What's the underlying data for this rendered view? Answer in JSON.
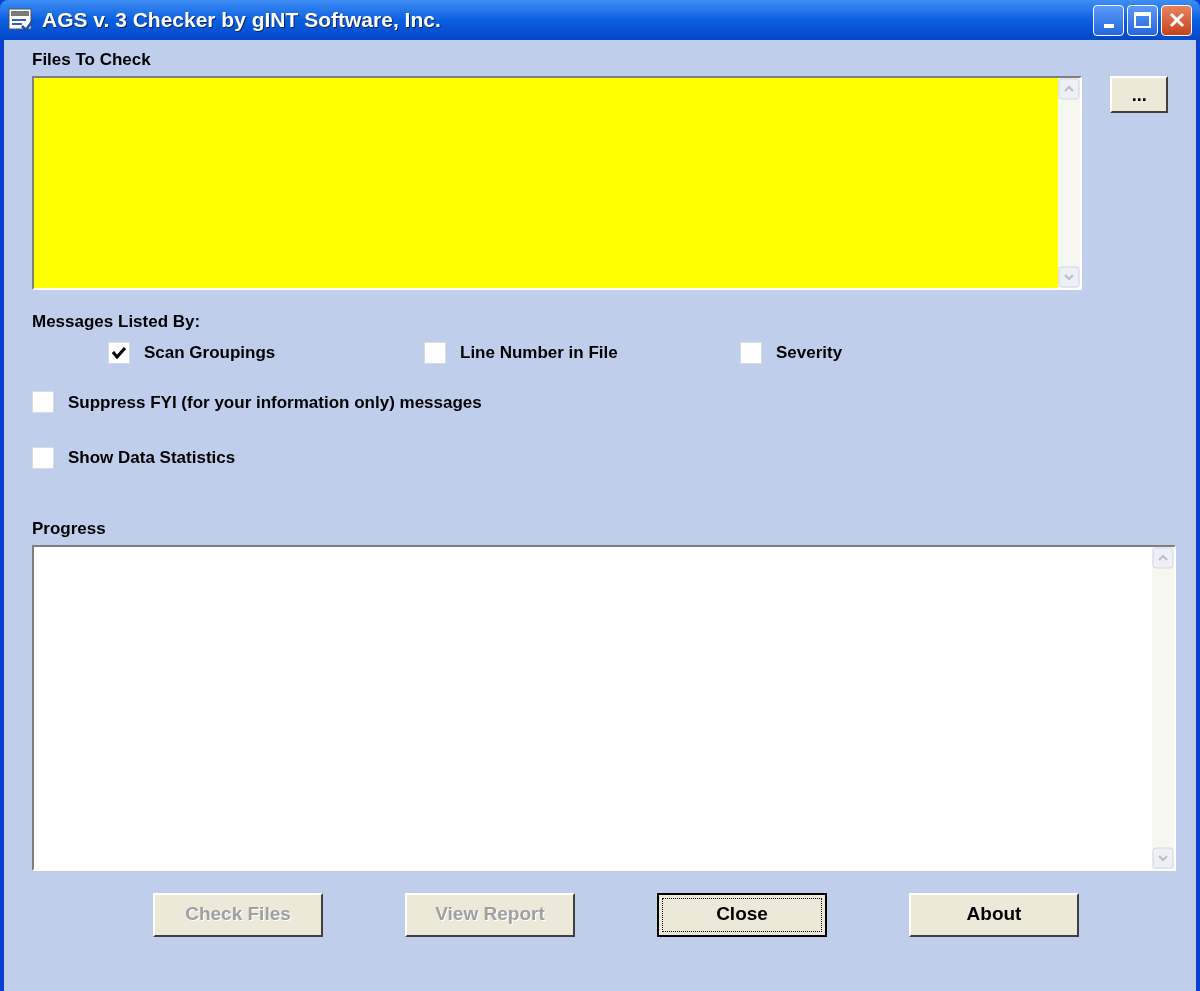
{
  "window": {
    "title": "AGS v. 3 Checker by gINT Software, Inc."
  },
  "files_to_check": {
    "label": "Files To Check",
    "browse_button": "..."
  },
  "messages_listed_by": {
    "label": "Messages Listed By:",
    "options": [
      {
        "label": "Scan Groupings",
        "checked": true
      },
      {
        "label": "Line Number in File",
        "checked": false
      },
      {
        "label": "Severity",
        "checked": false
      }
    ]
  },
  "options": [
    {
      "label": "Suppress FYI (for your information only) messages",
      "checked": false
    },
    {
      "label": "Show Data Statistics",
      "checked": false
    }
  ],
  "progress": {
    "label": "Progress"
  },
  "buttons": [
    {
      "label": "Check Files",
      "disabled": true,
      "focused": false
    },
    {
      "label": "View Report",
      "disabled": true,
      "focused": false
    },
    {
      "label": "Close",
      "disabled": false,
      "focused": true
    },
    {
      "label": "About",
      "disabled": false,
      "focused": false
    }
  ]
}
